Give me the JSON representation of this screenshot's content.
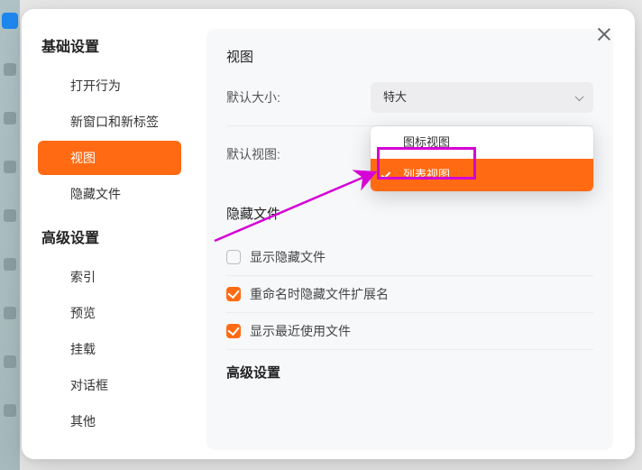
{
  "sidebar": {
    "groups": [
      {
        "title": "基础设置",
        "items": [
          {
            "label": "打开行为"
          },
          {
            "label": "新窗口和新标签"
          },
          {
            "label": "视图",
            "active": true
          },
          {
            "label": "隐藏文件"
          }
        ]
      },
      {
        "title": "高级设置",
        "items": [
          {
            "label": "索引"
          },
          {
            "label": "预览"
          },
          {
            "label": "挂载"
          },
          {
            "label": "对话框"
          },
          {
            "label": "其他"
          }
        ]
      }
    ]
  },
  "panel": {
    "section_view": "视图",
    "default_size_label": "默认大小:",
    "default_size_value": "特大",
    "default_view_label": "默认视图:",
    "view_options": [
      {
        "label": "图标视图",
        "selected": false
      },
      {
        "label": "列表视图",
        "selected": true
      }
    ],
    "section_hidden": "隐藏文件",
    "checkboxes": [
      {
        "label": "显示隐藏文件",
        "checked": false
      },
      {
        "label": "重命名时隐藏文件扩展名",
        "checked": true
      },
      {
        "label": "显示最近使用文件",
        "checked": true
      }
    ],
    "section_advanced": "高级设置"
  }
}
